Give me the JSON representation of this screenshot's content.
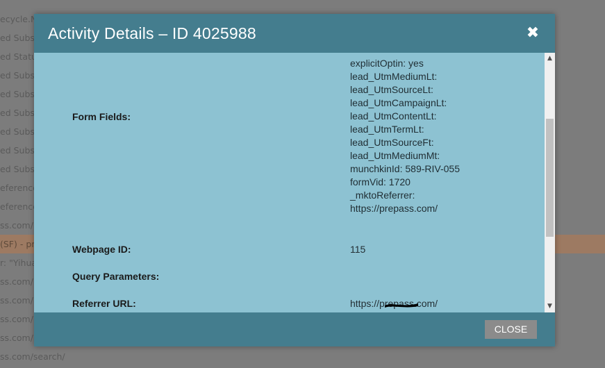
{
  "background_rows": [
    "ecycle.N",
    "ed Subs",
    "ed Status",
    "ed Subs",
    "ed Subs",
    "ed Subs",
    "ed Subs",
    "ed Subs",
    "ed Subs",
    "eference",
    "eference",
    "ss.com/",
    "(SF) - pre",
    "r: \"Yihuar",
    "ss.com/",
    "ss.com/",
    "ss.com/",
    "ss.com/",
    "ss.com/search/"
  ],
  "modal": {
    "title": "Activity Details – ID 4025988",
    "close_icon": "close-icon",
    "fields": {
      "form_fields_label": "Form Fields:",
      "form_fields_lines": [
        "explicitOptin: yes",
        "lead_UtmMediumLt:",
        "lead_UtmSourceLt:",
        "lead_UtmCampaignLt:",
        "lead_UtmContentLt:",
        "lead_UtmTermLt:",
        "lead_UtmSourceFt:",
        "lead_UtmMediumMt:",
        "munchkinId: 589-RIV-055",
        "formVid: 1720",
        "_mktoReferrer:",
        "https://prepass.com/"
      ],
      "webpage_id_label": "Webpage ID:",
      "webpage_id_value": "115",
      "query_parameters_label": "Query Parameters:",
      "referrer_url_label": "Referrer URL:",
      "referrer_url_value": "https://prepass.com/"
    },
    "footer": {
      "close_label": "CLOSE"
    }
  },
  "colors": {
    "header": "#447d8e",
    "body": "#8dc2d2",
    "button": "#8b8b8b",
    "highlight_row": "#9d7a62"
  }
}
